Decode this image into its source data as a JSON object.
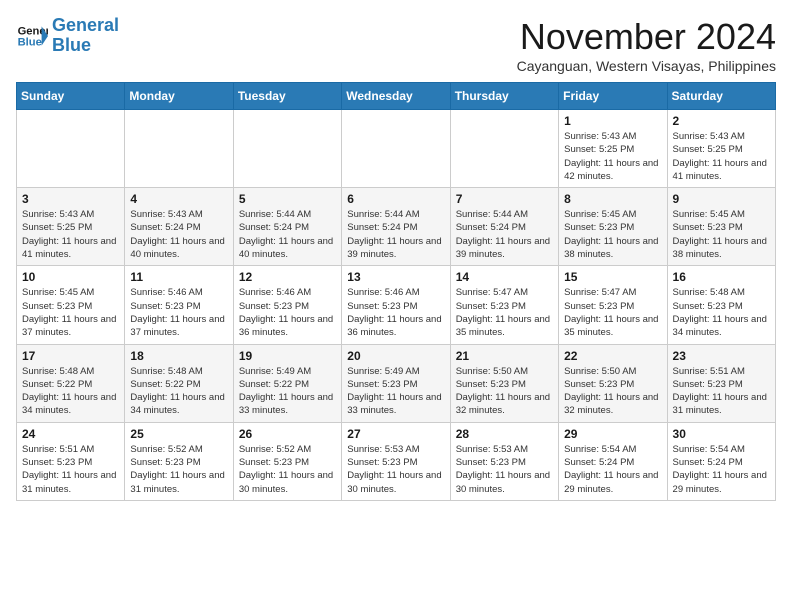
{
  "logo": {
    "line1": "General",
    "line2": "Blue"
  },
  "title": "November 2024",
  "subtitle": "Cayanguan, Western Visayas, Philippines",
  "weekdays": [
    "Sunday",
    "Monday",
    "Tuesday",
    "Wednesday",
    "Thursday",
    "Friday",
    "Saturday"
  ],
  "weeks": [
    [
      {
        "day": "",
        "info": ""
      },
      {
        "day": "",
        "info": ""
      },
      {
        "day": "",
        "info": ""
      },
      {
        "day": "",
        "info": ""
      },
      {
        "day": "",
        "info": ""
      },
      {
        "day": "1",
        "info": "Sunrise: 5:43 AM\nSunset: 5:25 PM\nDaylight: 11 hours and 42 minutes."
      },
      {
        "day": "2",
        "info": "Sunrise: 5:43 AM\nSunset: 5:25 PM\nDaylight: 11 hours and 41 minutes."
      }
    ],
    [
      {
        "day": "3",
        "info": "Sunrise: 5:43 AM\nSunset: 5:25 PM\nDaylight: 11 hours and 41 minutes."
      },
      {
        "day": "4",
        "info": "Sunrise: 5:43 AM\nSunset: 5:24 PM\nDaylight: 11 hours and 40 minutes."
      },
      {
        "day": "5",
        "info": "Sunrise: 5:44 AM\nSunset: 5:24 PM\nDaylight: 11 hours and 40 minutes."
      },
      {
        "day": "6",
        "info": "Sunrise: 5:44 AM\nSunset: 5:24 PM\nDaylight: 11 hours and 39 minutes."
      },
      {
        "day": "7",
        "info": "Sunrise: 5:44 AM\nSunset: 5:24 PM\nDaylight: 11 hours and 39 minutes."
      },
      {
        "day": "8",
        "info": "Sunrise: 5:45 AM\nSunset: 5:23 PM\nDaylight: 11 hours and 38 minutes."
      },
      {
        "day": "9",
        "info": "Sunrise: 5:45 AM\nSunset: 5:23 PM\nDaylight: 11 hours and 38 minutes."
      }
    ],
    [
      {
        "day": "10",
        "info": "Sunrise: 5:45 AM\nSunset: 5:23 PM\nDaylight: 11 hours and 37 minutes."
      },
      {
        "day": "11",
        "info": "Sunrise: 5:46 AM\nSunset: 5:23 PM\nDaylight: 11 hours and 37 minutes."
      },
      {
        "day": "12",
        "info": "Sunrise: 5:46 AM\nSunset: 5:23 PM\nDaylight: 11 hours and 36 minutes."
      },
      {
        "day": "13",
        "info": "Sunrise: 5:46 AM\nSunset: 5:23 PM\nDaylight: 11 hours and 36 minutes."
      },
      {
        "day": "14",
        "info": "Sunrise: 5:47 AM\nSunset: 5:23 PM\nDaylight: 11 hours and 35 minutes."
      },
      {
        "day": "15",
        "info": "Sunrise: 5:47 AM\nSunset: 5:23 PM\nDaylight: 11 hours and 35 minutes."
      },
      {
        "day": "16",
        "info": "Sunrise: 5:48 AM\nSunset: 5:23 PM\nDaylight: 11 hours and 34 minutes."
      }
    ],
    [
      {
        "day": "17",
        "info": "Sunrise: 5:48 AM\nSunset: 5:22 PM\nDaylight: 11 hours and 34 minutes."
      },
      {
        "day": "18",
        "info": "Sunrise: 5:48 AM\nSunset: 5:22 PM\nDaylight: 11 hours and 34 minutes."
      },
      {
        "day": "19",
        "info": "Sunrise: 5:49 AM\nSunset: 5:22 PM\nDaylight: 11 hours and 33 minutes."
      },
      {
        "day": "20",
        "info": "Sunrise: 5:49 AM\nSunset: 5:23 PM\nDaylight: 11 hours and 33 minutes."
      },
      {
        "day": "21",
        "info": "Sunrise: 5:50 AM\nSunset: 5:23 PM\nDaylight: 11 hours and 32 minutes."
      },
      {
        "day": "22",
        "info": "Sunrise: 5:50 AM\nSunset: 5:23 PM\nDaylight: 11 hours and 32 minutes."
      },
      {
        "day": "23",
        "info": "Sunrise: 5:51 AM\nSunset: 5:23 PM\nDaylight: 11 hours and 31 minutes."
      }
    ],
    [
      {
        "day": "24",
        "info": "Sunrise: 5:51 AM\nSunset: 5:23 PM\nDaylight: 11 hours and 31 minutes."
      },
      {
        "day": "25",
        "info": "Sunrise: 5:52 AM\nSunset: 5:23 PM\nDaylight: 11 hours and 31 minutes."
      },
      {
        "day": "26",
        "info": "Sunrise: 5:52 AM\nSunset: 5:23 PM\nDaylight: 11 hours and 30 minutes."
      },
      {
        "day": "27",
        "info": "Sunrise: 5:53 AM\nSunset: 5:23 PM\nDaylight: 11 hours and 30 minutes."
      },
      {
        "day": "28",
        "info": "Sunrise: 5:53 AM\nSunset: 5:23 PM\nDaylight: 11 hours and 30 minutes."
      },
      {
        "day": "29",
        "info": "Sunrise: 5:54 AM\nSunset: 5:24 PM\nDaylight: 11 hours and 29 minutes."
      },
      {
        "day": "30",
        "info": "Sunrise: 5:54 AM\nSunset: 5:24 PM\nDaylight: 11 hours and 29 minutes."
      }
    ]
  ]
}
